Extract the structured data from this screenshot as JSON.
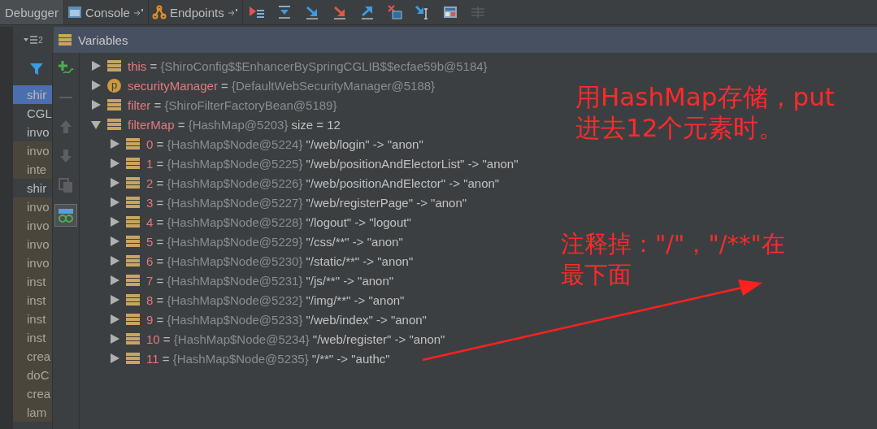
{
  "tabs": [
    {
      "label": "Debugger",
      "selected": true,
      "kind": "plain"
    },
    {
      "label": "Console",
      "selected": false,
      "kind": "console"
    },
    {
      "label": "Endpoints",
      "selected": false,
      "kind": "endpoints"
    }
  ],
  "toolbar": [
    {
      "kind": "execution-point",
      "disabled": false
    },
    {
      "kind": "step-over",
      "disabled": false
    },
    {
      "kind": "step-into",
      "disabled": false
    },
    {
      "kind": "force-step-into",
      "disabled": false
    },
    {
      "kind": "step-out",
      "disabled": false
    },
    {
      "kind": "drop-frame",
      "disabled": false
    },
    {
      "kind": "run-to-cursor",
      "disabled": false
    },
    {
      "kind": "evaluate",
      "disabled": false
    },
    {
      "kind": "trace",
      "disabled": true
    }
  ],
  "threads_button": {
    "count": "2"
  },
  "variables_panel": {
    "title": "Variables"
  },
  "side_toolbar": [
    {
      "kind": "add-watch",
      "disabled": false,
      "selected": false
    },
    {
      "kind": "remove",
      "disabled": true,
      "selected": false
    },
    {
      "kind": "up",
      "disabled": true,
      "selected": false
    },
    {
      "kind": "down",
      "disabled": true,
      "selected": false
    },
    {
      "kind": "copy",
      "disabled": true,
      "selected": false
    },
    {
      "kind": "watches",
      "disabled": false,
      "selected": true
    }
  ],
  "frames": [
    {
      "label": "shir",
      "selected": true,
      "library": false
    },
    {
      "label": "CGL",
      "selected": false,
      "library": false
    },
    {
      "label": "invo",
      "selected": false,
      "library": false
    },
    {
      "label": "invo",
      "selected": false,
      "library": true
    },
    {
      "label": "inte",
      "selected": false,
      "library": true
    },
    {
      "label": "shir",
      "selected": false,
      "library": false
    },
    {
      "label": "invo",
      "selected": false,
      "library": true
    },
    {
      "label": "invo",
      "selected": false,
      "library": true
    },
    {
      "label": "invo",
      "selected": false,
      "library": true
    },
    {
      "label": "invo",
      "selected": false,
      "library": true
    },
    {
      "label": "inst",
      "selected": false,
      "library": true
    },
    {
      "label": "inst",
      "selected": false,
      "library": true
    },
    {
      "label": "inst",
      "selected": false,
      "library": true
    },
    {
      "label": "inst",
      "selected": false,
      "library": true
    },
    {
      "label": "crea",
      "selected": false,
      "library": true
    },
    {
      "label": "doC",
      "selected": false,
      "library": true
    },
    {
      "label": "crea",
      "selected": false,
      "library": true
    },
    {
      "label": "lam",
      "selected": false,
      "library": true
    }
  ],
  "variables": [
    {
      "name": "this",
      "kind": "field",
      "value": "{ShiroConfig$$EnhancerBySpringCGLIB$$ecfae59b@5184}",
      "expanded": false
    },
    {
      "name": "securityManager",
      "kind": "property",
      "icon_letter": "p",
      "value": "{DefaultWebSecurityManager@5188}",
      "expanded": false
    },
    {
      "name": "filter",
      "kind": "field",
      "value": "{ShiroFilterFactoryBean@5189}",
      "expanded": false
    },
    {
      "name": "filterMap",
      "kind": "field",
      "value": "{HashMap@5203}",
      "detail": "size = 12",
      "expanded": true,
      "children": [
        {
          "name": "0",
          "kind": "field",
          "value": "{HashMap$Node@5224}",
          "detail": "\"/web/login\" -> \"anon\"",
          "expanded": false
        },
        {
          "name": "1",
          "kind": "field",
          "value": "{HashMap$Node@5225}",
          "detail": "\"/web/positionAndElectorList\" -> \"anon\"",
          "expanded": false
        },
        {
          "name": "2",
          "kind": "field",
          "value": "{HashMap$Node@5226}",
          "detail": "\"/web/positionAndElector\" -> \"anon\"",
          "expanded": false
        },
        {
          "name": "3",
          "kind": "field",
          "value": "{HashMap$Node@5227}",
          "detail": "\"/web/registerPage\" -> \"anon\"",
          "expanded": false
        },
        {
          "name": "4",
          "kind": "field",
          "value": "{HashMap$Node@5228}",
          "detail": "\"/logout\" -> \"logout\"",
          "expanded": false
        },
        {
          "name": "5",
          "kind": "field",
          "value": "{HashMap$Node@5229}",
          "detail": "\"/css/**\" -> \"anon\"",
          "expanded": false
        },
        {
          "name": "6",
          "kind": "field",
          "value": "{HashMap$Node@5230}",
          "detail": "\"/static/**\" -> \"anon\"",
          "expanded": false
        },
        {
          "name": "7",
          "kind": "field",
          "value": "{HashMap$Node@5231}",
          "detail": "\"/js/**\" -> \"anon\"",
          "expanded": false
        },
        {
          "name": "8",
          "kind": "field",
          "value": "{HashMap$Node@5232}",
          "detail": "\"/img/**\" -> \"anon\"",
          "expanded": false
        },
        {
          "name": "9",
          "kind": "field",
          "value": "{HashMap$Node@5233}",
          "detail": "\"/web/index\" -> \"anon\"",
          "expanded": false
        },
        {
          "name": "10",
          "kind": "field",
          "value": "{HashMap$Node@5234}",
          "detail": "\"/web/register\" -> \"anon\"",
          "expanded": false
        },
        {
          "name": "11",
          "kind": "field",
          "value": "{HashMap$Node@5235}",
          "detail": "\"/**\" -> \"authc\"",
          "expanded": false
        }
      ]
    }
  ],
  "separators": [
    "=",
    "=",
    "=",
    "=",
    "=",
    "=",
    "=",
    "=",
    "=",
    "=",
    "=",
    "=",
    "=",
    "=",
    "=",
    "="
  ],
  "annotations": [
    {
      "kind": "note",
      "lines": [
        "用HashMap存储，put",
        "进去12个元素时。"
      ]
    },
    {
      "kind": "note-with-arrow",
      "lines": [
        "注释掉：\"/\"，\"/**\"在",
        "最下面"
      ]
    }
  ]
}
